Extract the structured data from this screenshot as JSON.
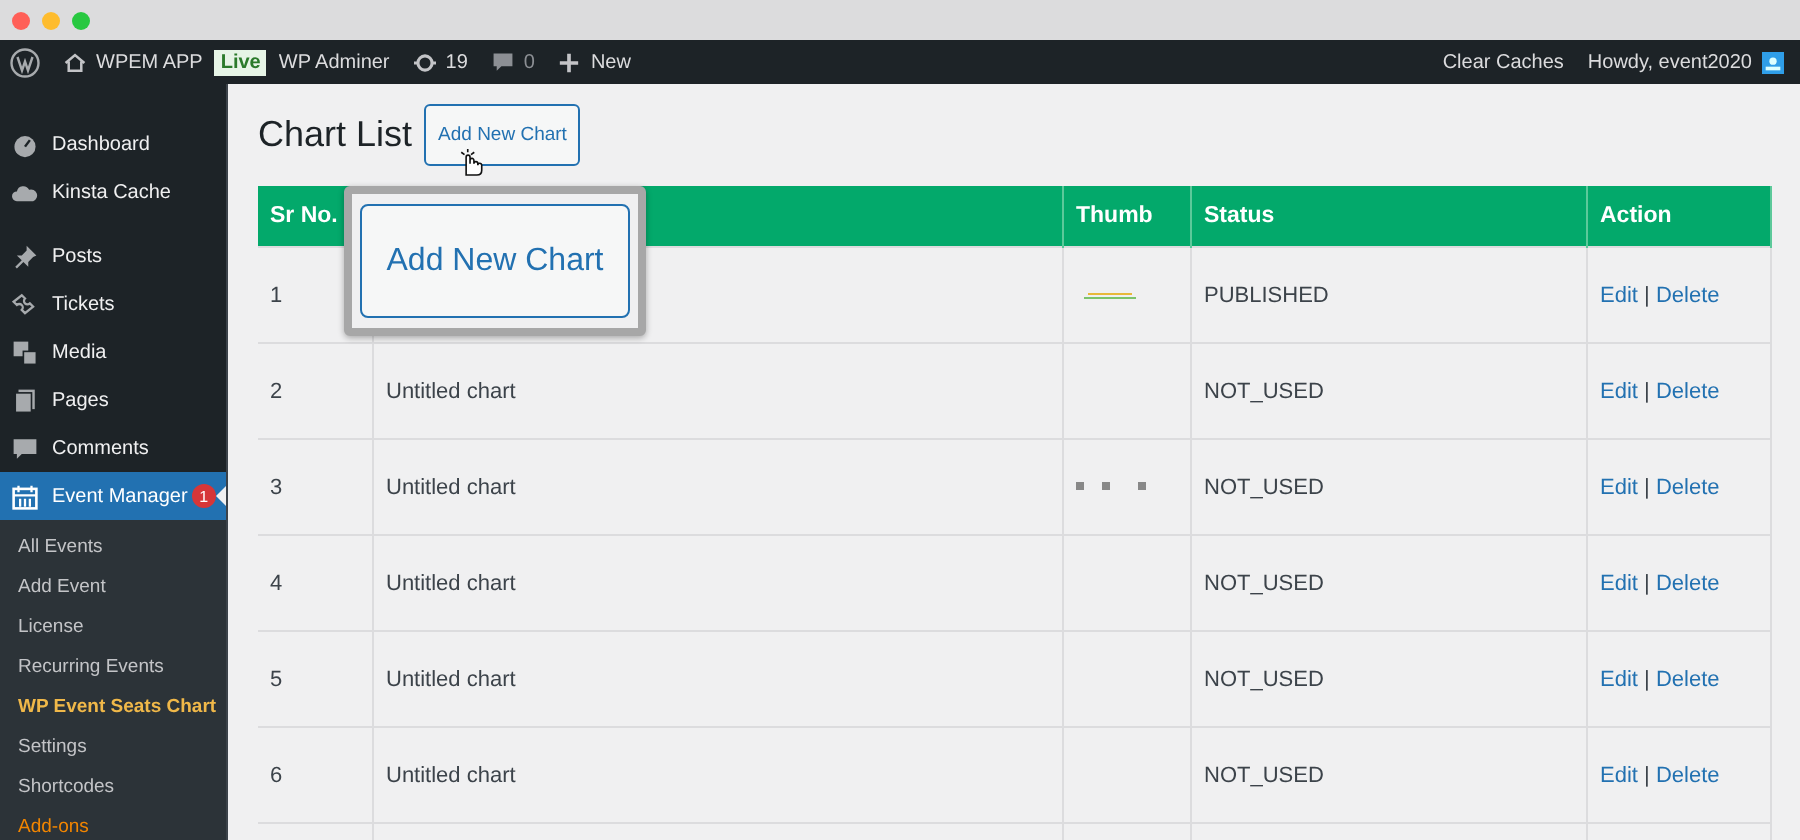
{
  "admin_bar": {
    "site": "WPEM APP",
    "live_badge": "Live",
    "site_name": "WP Adminer",
    "updates": "19",
    "comments": "0",
    "new": "New",
    "clear_caches": "Clear Caches",
    "greeting": "Howdy, event2020"
  },
  "sidebar": {
    "items": [
      {
        "label": "Dashboard",
        "selected": false
      },
      {
        "label": "Kinsta Cache",
        "selected": false
      },
      {
        "label": "Posts",
        "selected": false
      },
      {
        "label": "Tickets",
        "selected": false
      },
      {
        "label": "Media",
        "selected": false
      },
      {
        "label": "Pages",
        "selected": false
      },
      {
        "label": "Comments",
        "selected": false
      },
      {
        "label": "Event Manager",
        "selected": true,
        "badge": "1"
      }
    ],
    "submenu": [
      {
        "label": "All Events",
        "selected": false,
        "kind": "normal"
      },
      {
        "label": "Add Event",
        "selected": false,
        "kind": "normal"
      },
      {
        "label": "License",
        "selected": false,
        "kind": "normal"
      },
      {
        "label": "Recurring Events",
        "selected": false,
        "kind": "normal"
      },
      {
        "label": "WP Event Seats Chart",
        "selected": true,
        "kind": "normal"
      },
      {
        "label": "Settings",
        "selected": false,
        "kind": "normal"
      },
      {
        "label": "Shortcodes",
        "selected": false,
        "kind": "normal"
      },
      {
        "label": "Add-ons",
        "selected": false,
        "kind": "addon"
      }
    ]
  },
  "page": {
    "title": "Chart List",
    "add_button": "Add New Chart",
    "callout": "Add New Chart"
  },
  "table": {
    "columns": [
      "Sr No.",
      "",
      "Thumb",
      "Status",
      "Action"
    ],
    "rows": [
      {
        "sr": "1",
        "kind": "line",
        "status": "PUBLISHED",
        "edit": "Edit",
        "sep": "|",
        "delete": "Delete"
      },
      {
        "sr": "2",
        "name": "Untitled chart",
        "kind": "plain",
        "status": "NOT_USED",
        "edit": "Edit",
        "sep": "|",
        "delete": "Delete"
      },
      {
        "sr": "3",
        "name": "Untitled chart",
        "kind": "dots",
        "status": "NOT_USED",
        "edit": "Edit",
        "sep": "|",
        "delete": "Delete"
      },
      {
        "sr": "4",
        "name": "Untitled chart",
        "kind": "plain",
        "status": "NOT_USED",
        "edit": "Edit",
        "sep": "|",
        "delete": "Delete"
      },
      {
        "sr": "5",
        "name": "Untitled chart",
        "kind": "plain",
        "status": "NOT_USED",
        "edit": "Edit",
        "sep": "|",
        "delete": "Delete"
      },
      {
        "sr": "6",
        "name": "Untitled chart",
        "kind": "plain",
        "status": "NOT_USED",
        "edit": "Edit",
        "sep": "|",
        "delete": "Delete"
      }
    ]
  }
}
